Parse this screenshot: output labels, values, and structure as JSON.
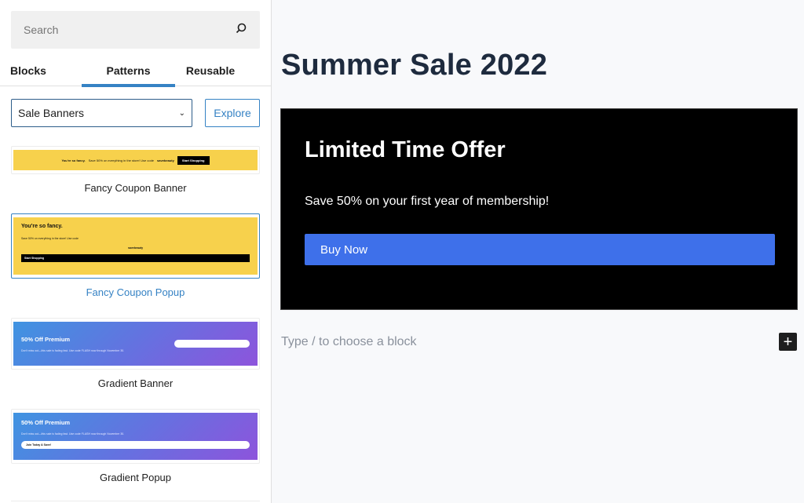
{
  "sidebar": {
    "search": {
      "placeholder": "Search",
      "icon": "search-icon"
    },
    "tabs": [
      {
        "label": "Blocks",
        "active": false
      },
      {
        "label": "Patterns",
        "active": true
      },
      {
        "label": "Reusable",
        "active": false
      }
    ],
    "category": {
      "selected": "Sale Banners",
      "icon": "chevron-down-icon"
    },
    "explore_label": "Explore",
    "patterns": [
      {
        "label": "Fancy Coupon Banner",
        "selected": false,
        "preview": {
          "heading": "You're so fancy.",
          "text": "Save 50% on everything in the store! Use code",
          "code": "savebeauty",
          "button": "Start Shopping"
        }
      },
      {
        "label": "Fancy Coupon Popup",
        "selected": true,
        "preview": {
          "heading": "You're so fancy.",
          "text": "Save 50% on everything in the store! Use code",
          "code": "savebeauty",
          "button": "Start Shopping"
        }
      },
      {
        "label": "Gradient Banner",
        "selected": false,
        "preview": {
          "heading": "50% Off Premium",
          "text": "Don't miss out—this sale is fading fast. Use code FLASH now through November 30."
        }
      },
      {
        "label": "Gradient Popup",
        "selected": false,
        "preview": {
          "heading": "50% Off Premium",
          "text": "Don't miss out—this sale is fading fast. Use code FLASH now through November 30.",
          "button": "Join Today & Save!"
        }
      }
    ]
  },
  "editor": {
    "title": "Summer Sale 2022",
    "cover": {
      "heading": "Limited Time Offer",
      "text": "Save 50% on your first year of membership!",
      "button": "Buy Now"
    },
    "appender_placeholder": "Type / to choose a block",
    "add_block_icon": "plus-icon"
  },
  "colors": {
    "accent": "#3582c4",
    "buy_button": "#3e70ea",
    "coupon_yellow": "#f7d14c",
    "title": "#1e2b3e"
  }
}
